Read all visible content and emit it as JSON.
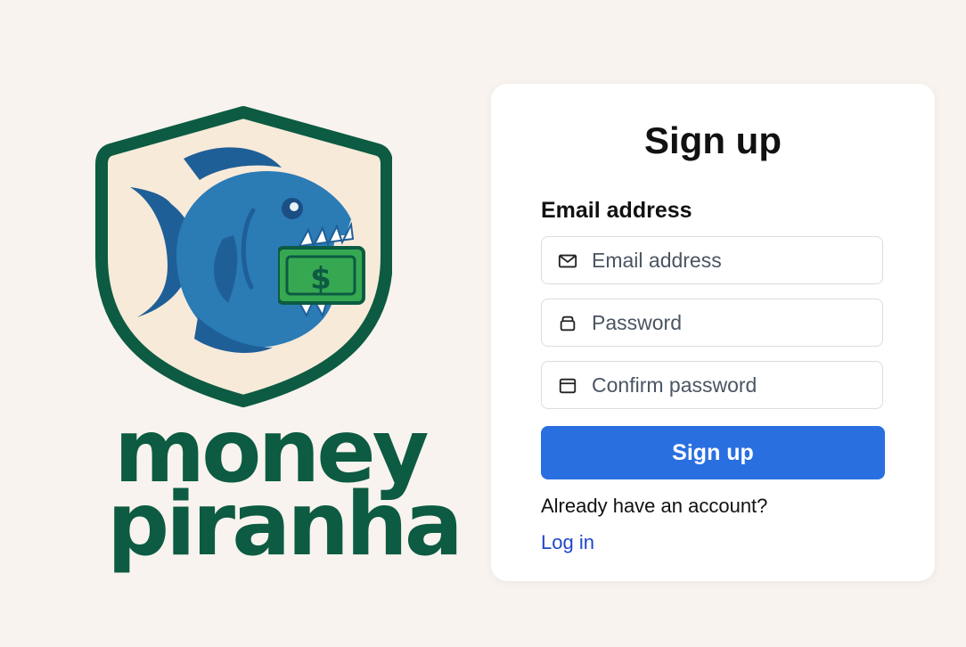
{
  "brand": {
    "name_line1": "money",
    "name_line2": "piranha",
    "logo_icon": "piranha-with-dollar-shield-logo",
    "logo_dollar_symbol": "$",
    "brand_color": "#0c5b42",
    "fish_color": "#2b7bb5",
    "cash_color": "#36a852"
  },
  "form": {
    "title": "Sign up",
    "email_label": "Email address",
    "email_placeholder": "Email address",
    "email_value": "",
    "email_icon": "mail-icon",
    "password_placeholder": "Password",
    "password_value": "",
    "password_icon": "lock-icon",
    "confirm_placeholder": "Confirm password",
    "confirm_value": "",
    "confirm_icon": "lock-icon",
    "submit_label": "Sign up",
    "submit_color": "#2a6fe0",
    "account_prompt": "Already have an account?",
    "login_link": "Log in",
    "link_color": "#1f47c9"
  },
  "theme": {
    "background": "#f8f3ee",
    "card_background": "#ffffff"
  }
}
